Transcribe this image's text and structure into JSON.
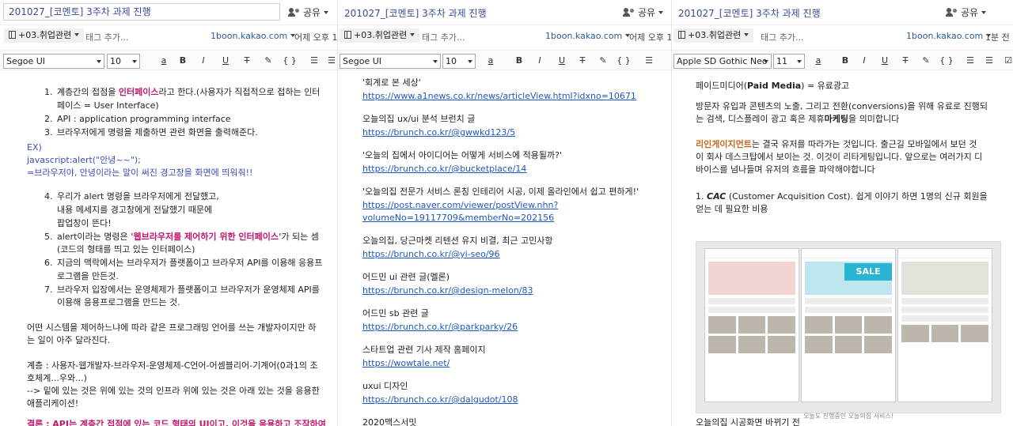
{
  "panes": [
    {
      "title": "201027_[코멘토] 3주차 과제 진행",
      "share": "공유",
      "notebook": "+03.취업관련",
      "tag_placeholder": "태그 추가...",
      "site": "1boon.kakao.com",
      "date": "어제 오후 1",
      "font": "Segoe UI",
      "size": "10"
    },
    {
      "title": "201027_[코멘토] 3주차 과제 진행",
      "share": "공유",
      "notebook": "+03.취업관련",
      "tag_placeholder": "태그 추가...",
      "site": "1boon.kakao.com",
      "date": "어제 오후 1",
      "font": "Segoe UI",
      "size": "10"
    },
    {
      "title": "201027_[코멘토] 3주차 과제 진행",
      "share": "공유",
      "notebook": "+03.취업관련",
      "tag_placeholder": "태그 추가...",
      "site": "1boon.kakao.com",
      "date": "1분 전",
      "font": "Apple SD Gothic Neo",
      "size": "11"
    }
  ],
  "toolbar": {
    "font_color": "a",
    "bold": "B",
    "italic": "I",
    "underline": "U",
    "strike": "T",
    "highlight": "✎",
    "code": "{ }",
    "list": "☰"
  },
  "note1": {
    "l1_num": "1.",
    "l1a": "계층간의 접점을 ",
    "l1b": "인터페이스",
    "l1c": "라고 한다.(사용자가 직접적으로 접하는 인터",
    "l1d": "페이스 = User Interface)",
    "l2_num": "2.",
    "l2": "API : application programming interface",
    "l3_num": "3.",
    "l3": "브라우저에게 명령을 제출하면 관련 화면을 출력해준다.",
    "ex1": "EX)",
    "ex2": "javascript:alert(\"안녕~~\");",
    "ex3": "=브라우저야, 안녕이라는 말이 써진 경고창을 화면에 띄워줘!!",
    "l4_num": "4.",
    "l4a": "우리가 alert 명령을 브라우저에게 전달했고,",
    "l4b": "내용 메세지를 경고창에게 전달했기 때문에",
    "l4c": "팝업창이 뜬다!",
    "l5_num": "5.",
    "l5a": "alert이라는 명령은 ",
    "l5b": "'웹브라우저를 제어하기 위한 인터페이스'",
    "l5c": "가 되는 셈",
    "l5d": "(코드의 형태를 띄고 있는 인터페이스)",
    "l6_num": "6.",
    "l6a": "지금의 맥락에서는 브라우저가 플랫폼이고 브라우저 API를 이용해 응용프",
    "l6b": "로그램을 만든것.",
    "l7_num": "7.",
    "l7a": "브라우저 입장에서는 운영체제가 플랫폼이고 브라우저가 운영체제 API를",
    "l7b": "이용해 응용프로그램을 만드는 것.",
    "p1a": "어떤 시스템을 제어하느냐에 따라 같은 프로그래밍 언어를 쓰는 개발자이지만 하",
    "p1b": "는 일이 아주 달라진다.",
    "p2a": "계층 : 사용자-웹개발자-브라우저-운영체제-C언어-어셈블리어-기계어(0과1의 조",
    "p2b": "호체계...우와...)",
    "p2c": "--> 밑에 있는 것은 위에 있는 것의 인프라 위에 있는 것은 아래 있는 것을 응용한",
    "p2d": "애플리케이션!",
    "p3": "결론 : API는 계층간 접점에 있는 코드 형태의 UI이고, 이것을 응용하고 조작하여"
  },
  "note2": [
    {
      "title": "'회계로 본 세상'",
      "url": "https://www.a1news.co.kr/news/articleView.html?idxno=10671"
    },
    {
      "title": "오늘의집 ux/ui 분석 브런치 글",
      "url": "https://brunch.co.kr/@gwwkd123/5"
    },
    {
      "title": "'오늘의 집에서 아이디어는 어떻게 서비스에 적용될까?'",
      "url": "https://brunch.co.kr/@bucketplace/14"
    },
    {
      "title": "'오늘의집 전문가 서비스 론칭 인테리어 시공, 이제 올라인에서 쉽고 편하게!'",
      "url": "https://post.naver.com/viewer/postView.nhn?",
      "url2": "volumeNo=19117709&memberNo=202156"
    },
    {
      "title": "오늘의집, 당근마켓 리텐션 유지 비결, 최근 고민사항",
      "url": "https://brunch.co.kr/@yi-seo/96"
    },
    {
      "title": "어드민 ui 관련 글(멜론)",
      "url": "https://brunch.co.kr/@design-melon/83"
    },
    {
      "title": "어드민 sb 관련 글",
      "url": "https://brunch.co.kr/@parkparky/26"
    },
    {
      "title": "스타트업 관련 기사 제작 홈페이지",
      "url": "https://wowtale.net/"
    },
    {
      "title": "uxui 디자인",
      "url": "https://brunch.co.kr/@dalgudot/108"
    },
    {
      "title": "2020맥스서밋",
      "url": ""
    }
  ],
  "note3": {
    "h1a": "페이드미디어(",
    "h1b": "Paid Media",
    "h1c": ") = 유료광고",
    "p1a": "방문자 유입과 콘텐츠의 노출, 그리고 전환(conversions)을 위해 유료로 진행되",
    "p1b": "는 검색, 디스플레이 광고 혹은 제휴",
    "p1c": "마케팅",
    "p1d": "을 의미합니다",
    "p2a": "리인게이지먼트",
    "p2b": "는 결국 유저를 따라가는 것입니다. 출근길 모바일에서 보던 것",
    "p2c": "이 회사 데스크탑에서 보이는 것. 이것이 리타게팅입니다. 앞으로는 여러가지 디",
    "p2d": "바이스를 넘나들며 유저의 흐름을 파악해야합니다",
    "p3a": "1. ",
    "p3b": "CAC",
    "p3c": " (Customer Acquisition Cost). 쉽게 이야기 하면 1명의 신규 회원을",
    "p3d": "얻는 데 필요한 비용",
    "sale": "SALE",
    "caption": "오늘도 진행중인 오늘의집 서비스!",
    "bottom": "오늘의집 시공화면 바뀌기 전"
  }
}
